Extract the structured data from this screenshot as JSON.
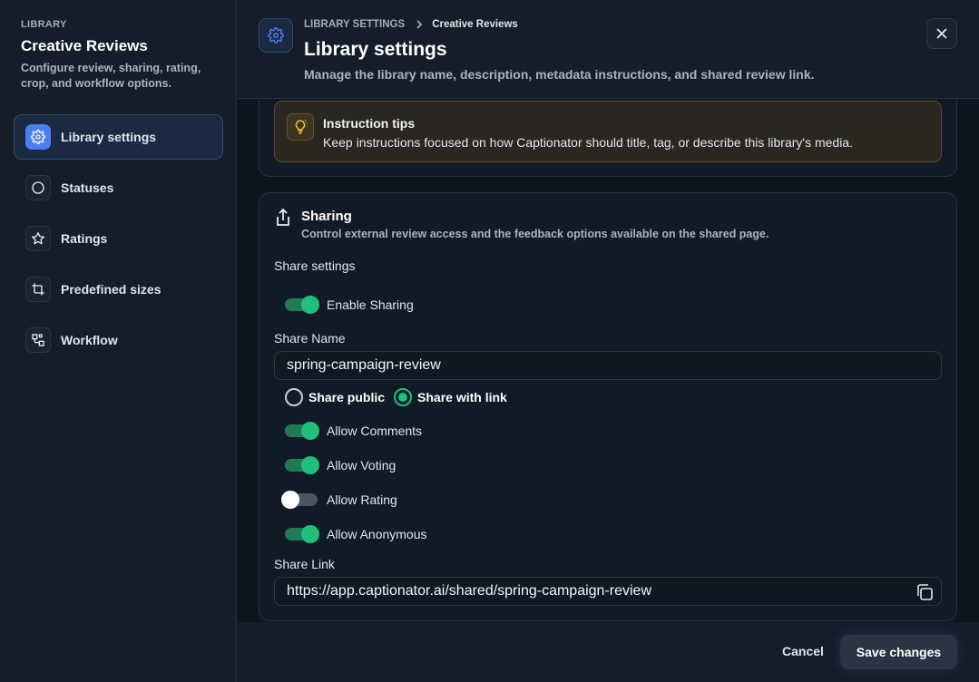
{
  "sidebar": {
    "eyebrow": "LIBRARY",
    "title": "Creative Reviews",
    "description": "Configure review, sharing, rating, crop, and workflow options.",
    "items": [
      {
        "label": "Library settings",
        "icon": "gear-icon",
        "active": true
      },
      {
        "label": "Statuses",
        "icon": "circle-icon",
        "active": false
      },
      {
        "label": "Ratings",
        "icon": "star-icon",
        "active": false
      },
      {
        "label": "Predefined sizes",
        "icon": "crop-icon",
        "active": false
      },
      {
        "label": "Workflow",
        "icon": "workflow-icon",
        "active": false
      }
    ]
  },
  "header": {
    "breadcrumb": [
      "LIBRARY SETTINGS",
      "Creative Reviews"
    ],
    "title": "Library settings",
    "description": "Manage the library name, description, metadata instructions, and shared review link."
  },
  "tips": {
    "title": "Instruction tips",
    "text": "Keep instructions focused on how Captionator should title, tag, or describe this library's media."
  },
  "sharing": {
    "title": "Sharing",
    "description": "Control external review access and the feedback options available on the shared page.",
    "settings_label": "Share settings",
    "enable_sharing": {
      "label": "Enable Sharing",
      "on": true
    },
    "share_name_label": "Share Name",
    "share_name_value": "spring-campaign-review",
    "radio_options": [
      {
        "label": "Share public",
        "checked": false
      },
      {
        "label": "Share with link",
        "checked": true
      }
    ],
    "toggles": [
      {
        "label": "Allow Comments",
        "on": true
      },
      {
        "label": "Allow Voting",
        "on": true
      },
      {
        "label": "Allow Rating",
        "on": false
      },
      {
        "label": "Allow Anonymous",
        "on": true
      }
    ],
    "share_link_label": "Share Link",
    "share_link_value": "https://app.captionator.ai/shared/spring-campaign-review"
  },
  "footer": {
    "cancel_label": "Cancel",
    "save_label": "Save changes"
  },
  "colors": {
    "accent_blue": "#4d7ef0",
    "toggle_green": "#21c07a",
    "tips_yellow": "#f2c23a"
  }
}
